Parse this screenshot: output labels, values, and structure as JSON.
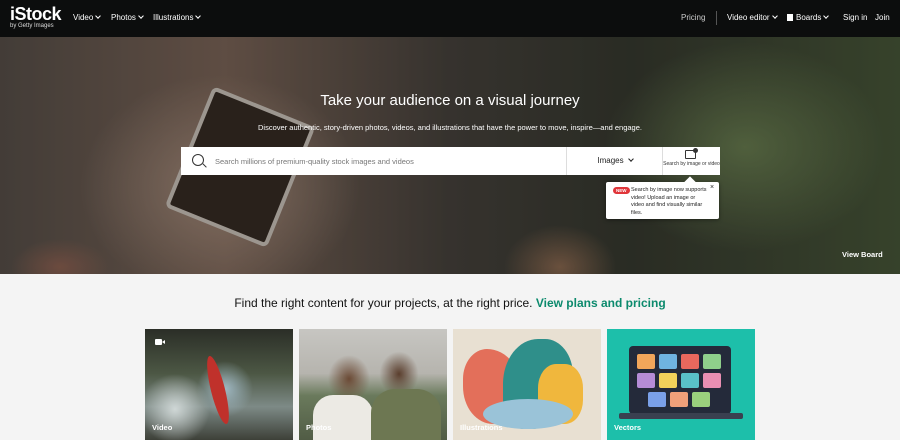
{
  "nav": {
    "logo_main": "iStock",
    "logo_sub": "by Getty Images",
    "left_items": [
      "Video",
      "Photos",
      "Illustrations"
    ],
    "pricing": "Pricing",
    "video_editor": "Video editor",
    "boards": "Boards",
    "sign_in": "Sign in",
    "join": "Join"
  },
  "hero": {
    "title": "Take your audience on a visual journey",
    "subtitle": "Discover authentic, story-driven photos, videos, and illustrations that have the power to move, inspire—and engage.",
    "search_placeholder": "Search millions of premium-quality stock images and videos",
    "search_type": "Images",
    "image_search_label": "Search by image or video",
    "tooltip_badge": "NEW",
    "tooltip_text": "Search by image now supports video! Upload an image or video and find visually similar files.",
    "tooltip_close": "×",
    "view_board": "View Board"
  },
  "lower": {
    "tagline": "Find the right content for your projects, at the right price.",
    "tagline_link": "View plans and pricing",
    "cards": [
      "Video",
      "Photos",
      "Illustrations",
      "Vectors"
    ]
  },
  "colors": {
    "nav_bg": "#0c0d0d",
    "accent_link": "#0c8a6d",
    "new_badge": "#e0353a",
    "vectors_bg": "#1dbfaa"
  },
  "icons": [
    "search-icon",
    "image-search-icon",
    "video-camera-icon",
    "boards-icon",
    "chevron-down-icon",
    "close-icon"
  ]
}
